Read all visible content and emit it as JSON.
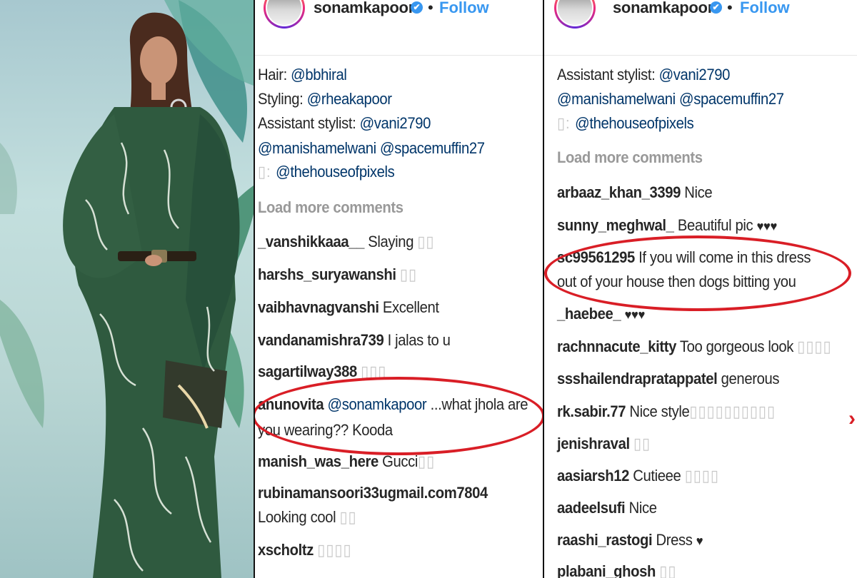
{
  "username": "sonamkapoor",
  "follow_label": "Follow",
  "separator": "•",
  "verified_glyph": "✔",
  "colors": {
    "link": "#003569",
    "follow": "#3897f0",
    "muted": "#999999",
    "highlight": "#d91e26",
    "dress": "#2f5a3f"
  },
  "left_panel": {
    "caption": [
      {
        "label": "Hair: ",
        "mention": "@bbhiral"
      },
      {
        "label": "Styling: ",
        "mention": "@rheakapoor"
      },
      {
        "label": "Assistant stylist: ",
        "mention": "@vani2790"
      },
      {
        "label": "",
        "mention": "@manishamelwani @spacemuffin27"
      },
      {
        "label": "▯: ",
        "mention": "@thehouseofpixels"
      }
    ],
    "load_more": "Load more comments",
    "comments": [
      {
        "user": "_vanshikkaaa__",
        "text": " Slaying ",
        "tail": "▯▯"
      },
      {
        "user": "harshs_suryawanshi",
        "text": " ",
        "tail": "▯▯"
      },
      {
        "user": "vaibhavnagvanshi",
        "text": " Excellent",
        "tail": ""
      },
      {
        "user": "vandanamishra739",
        "text": " I jalas to u",
        "tail": ""
      },
      {
        "user": "sagartilway388",
        "text": " ",
        "tail": "▯▯▯"
      },
      {
        "user": "anunovita",
        "mention": " @sonamkapoor",
        "text": " ...what jhola are",
        "tail": ""
      },
      {
        "user": "",
        "text": "you wearing?? Kooda",
        "tail": ""
      },
      {
        "user": "manish_was_here",
        "text": " Gucci",
        "tail": "▯▯"
      },
      {
        "user": "rubinamansoori33ugmail.com7804",
        "text": "",
        "tail": ""
      },
      {
        "user": "",
        "text": "Looking cool ",
        "tail": "▯▯"
      },
      {
        "user": "xscholtz",
        "text": " ",
        "tail": "▯▯▯▯"
      }
    ]
  },
  "right_panel": {
    "caption": [
      {
        "label": "Assistant stylist: ",
        "mention": "@vani2790"
      },
      {
        "label": "",
        "mention": "@manishamelwani @spacemuffin27"
      },
      {
        "label": "▯: ",
        "mention": "@thehouseofpixels"
      }
    ],
    "load_more": "Load more comments",
    "comments": [
      {
        "user": "arbaaz_khan_3399",
        "text": " Nice",
        "tail": ""
      },
      {
        "user": "sunny_meghwal_",
        "text": " Beautiful pic ",
        "tail": "♥♥♥"
      },
      {
        "user": "sc99561295",
        "text": " If you will come in this dress",
        "tail": ""
      },
      {
        "user": "",
        "text": "out of your house then dogs bitting you",
        "tail": ""
      },
      {
        "user": "_haebee_",
        "text": " ",
        "tail": "♥♥♥"
      },
      {
        "user": "rachnnacute_kitty",
        "text": " Too gorgeous look ",
        "tail": "▯▯▯▯"
      },
      {
        "user": "ssshailendrapratappatel",
        "text": " generous",
        "tail": ""
      },
      {
        "user": "rk.sabir.77",
        "text": " Nice style",
        "tail": "▯▯▯▯▯▯▯▯▯▯"
      },
      {
        "user": "jenishraval",
        "text": " ",
        "tail": "▯▯"
      },
      {
        "user": "aasiarsh12",
        "text": " Cutieee ",
        "tail": "▯▯▯▯"
      },
      {
        "user": "aadeelsufi",
        "text": " Nice",
        "tail": ""
      },
      {
        "user": "raashi_rastogi",
        "text": " Dress ",
        "tail": "♥"
      },
      {
        "user": "plabani_ghosh",
        "text": " ",
        "tail": "▯▯"
      }
    ]
  }
}
